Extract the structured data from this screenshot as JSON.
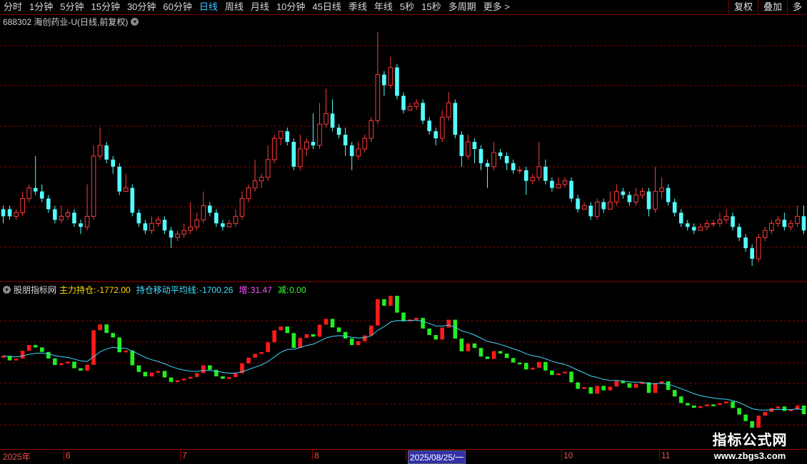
{
  "toolbar": {
    "tabs": [
      {
        "label": "分时",
        "active": false
      },
      {
        "label": "1分钟",
        "active": false
      },
      {
        "label": "5分钟",
        "active": false
      },
      {
        "label": "15分钟",
        "active": false
      },
      {
        "label": "30分钟",
        "active": false
      },
      {
        "label": "60分钟",
        "active": false
      },
      {
        "label": "日线",
        "active": true
      },
      {
        "label": "周线",
        "active": false
      },
      {
        "label": "月线",
        "active": false
      },
      {
        "label": "10分钟",
        "active": false
      },
      {
        "label": "45日线",
        "active": false
      },
      {
        "label": "季线",
        "active": false
      },
      {
        "label": "年线",
        "active": false
      },
      {
        "label": "5秒",
        "active": false
      },
      {
        "label": "15秒",
        "active": false
      },
      {
        "label": "多周期",
        "active": false
      },
      {
        "label": "更多 >",
        "active": false
      }
    ],
    "right_buttons": [
      "复权",
      "叠加",
      "多"
    ]
  },
  "price_panel": {
    "title": "688302 海创药业-U(日线,前复权)"
  },
  "indicator_panel": {
    "name": "股朋指标网",
    "main_label": "主力持仓:",
    "main_value": "-1772.00",
    "ma_label": "持仓移动平均线:",
    "ma_value": "-1700.26",
    "inc_label": "增:",
    "inc_value": "31.47",
    "dec_label": "减:",
    "dec_value": "0.00"
  },
  "colors": {
    "up": "#ff3b3b",
    "down": "#54ffff",
    "ma_line": "#3fd9ff",
    "ind_up": "#ff1a1a",
    "ind_down": "#22ee22",
    "grid": "#8a0000",
    "main_label": "#ffde00",
    "ma_label": "#40e0ff",
    "inc_label": "#ff55ff",
    "dec_label": "#33ff33"
  },
  "time_axis": {
    "labels": [
      "2025年",
      "6",
      "7",
      "8",
      "2025/08/25/一",
      "10",
      "11"
    ],
    "selected": "2025/08/25/一"
  },
  "watermark": {
    "line1": "指标公式网",
    "line2": "www.zbgs3.com"
  },
  "chart_data": {
    "type": "candlestick",
    "note_series": [
      "price ohlc (relative units)",
      "main force position",
      "position moving average"
    ],
    "candles": [
      [
        10,
        12,
        13,
        8,
        0
      ],
      [
        12,
        10,
        13,
        9,
        0
      ],
      [
        10,
        11,
        12,
        9,
        1
      ],
      [
        11,
        15,
        17,
        10,
        1
      ],
      [
        15,
        18,
        19,
        14,
        1
      ],
      [
        18,
        17,
        27,
        16,
        0
      ],
      [
        17,
        15,
        19,
        14,
        0
      ],
      [
        15,
        12,
        16,
        11,
        0
      ],
      [
        12,
        9,
        13,
        8,
        0
      ],
      [
        9,
        10,
        13,
        8,
        1
      ],
      [
        10,
        11,
        12,
        9,
        1
      ],
      [
        11,
        8,
        12,
        7,
        0
      ],
      [
        8,
        7,
        9,
        5,
        0
      ],
      [
        7,
        10,
        19,
        6,
        1
      ],
      [
        10,
        27,
        30,
        9,
        1
      ],
      [
        27,
        30,
        35,
        26,
        1
      ],
      [
        30,
        26,
        31,
        25,
        0
      ],
      [
        26,
        24,
        27,
        22,
        0
      ],
      [
        24,
        17,
        25,
        16,
        0
      ],
      [
        17,
        18,
        22,
        17,
        1
      ],
      [
        18,
        11,
        19,
        10,
        0
      ],
      [
        11,
        8,
        12,
        7,
        0
      ],
      [
        8,
        6,
        9,
        5,
        0
      ],
      [
        6,
        8,
        10,
        5,
        1
      ],
      [
        8,
        9,
        10,
        7,
        1
      ],
      [
        9,
        6,
        10,
        5,
        0
      ],
      [
        6,
        4,
        7,
        1,
        0
      ],
      [
        4,
        5,
        6,
        3,
        1
      ],
      [
        5,
        6,
        8,
        4,
        1
      ],
      [
        6,
        7,
        14,
        5,
        1
      ],
      [
        7,
        9,
        11,
        6,
        1
      ],
      [
        9,
        13,
        17,
        8,
        1
      ],
      [
        13,
        11,
        14,
        10,
        0
      ],
      [
        11,
        8,
        12,
        7,
        0
      ],
      [
        8,
        7,
        9,
        6,
        0
      ],
      [
        7,
        8,
        9,
        7,
        1
      ],
      [
        8,
        10,
        12,
        7,
        1
      ],
      [
        10,
        15,
        17,
        9,
        1
      ],
      [
        15,
        18,
        19,
        14,
        1
      ],
      [
        18,
        20,
        26,
        17,
        1
      ],
      [
        20,
        21,
        22,
        18,
        1
      ],
      [
        21,
        26,
        30,
        20,
        1
      ],
      [
        26,
        32,
        33,
        25,
        1
      ],
      [
        32,
        34,
        34,
        30,
        1
      ],
      [
        34,
        31,
        35,
        30,
        0
      ],
      [
        31,
        24,
        32,
        23,
        0
      ],
      [
        24,
        29,
        33,
        23,
        1
      ],
      [
        29,
        31,
        32,
        27,
        1
      ],
      [
        31,
        30,
        39,
        29,
        0
      ],
      [
        30,
        36,
        42,
        29,
        1
      ],
      [
        36,
        39,
        46,
        35,
        1
      ],
      [
        39,
        35,
        43,
        34,
        0
      ],
      [
        35,
        33,
        36,
        32,
        0
      ],
      [
        33,
        30,
        35,
        27,
        0
      ],
      [
        30,
        27,
        31,
        23,
        0
      ],
      [
        27,
        29,
        31,
        26,
        1
      ],
      [
        29,
        32,
        33,
        28,
        1
      ],
      [
        32,
        37,
        38,
        31,
        1
      ],
      [
        37,
        50,
        62,
        36,
        1
      ],
      [
        50,
        47,
        51,
        44,
        0
      ],
      [
        47,
        52,
        55,
        46,
        1
      ],
      [
        52,
        44,
        53,
        43,
        0
      ],
      [
        44,
        40,
        45,
        39,
        0
      ],
      [
        40,
        41,
        42,
        40,
        1
      ],
      [
        41,
        42,
        43,
        40,
        1
      ],
      [
        42,
        37,
        43,
        36,
        0
      ],
      [
        37,
        34,
        38,
        33,
        0
      ],
      [
        34,
        32,
        35,
        30,
        0
      ],
      [
        32,
        38,
        40,
        31,
        1
      ],
      [
        38,
        42,
        45,
        37,
        1
      ],
      [
        42,
        33,
        43,
        32,
        0
      ],
      [
        33,
        27,
        34,
        24,
        0
      ],
      [
        27,
        31,
        33,
        26,
        1
      ],
      [
        31,
        29,
        32,
        25,
        0
      ],
      [
        29,
        25,
        30,
        23,
        0
      ],
      [
        25,
        24,
        26,
        18,
        0
      ],
      [
        24,
        28,
        31,
        23,
        1
      ],
      [
        28,
        27,
        29,
        26,
        0
      ],
      [
        27,
        25,
        28,
        23,
        0
      ],
      [
        25,
        23,
        26,
        22,
        0
      ],
      [
        23,
        23,
        24,
        22,
        1
      ],
      [
        23,
        20,
        24,
        16,
        0
      ],
      [
        20,
        21,
        22,
        19,
        1
      ],
      [
        21,
        24,
        31,
        20,
        1
      ],
      [
        24,
        20,
        26,
        19,
        0
      ],
      [
        20,
        18,
        21,
        17,
        0
      ],
      [
        18,
        19,
        21,
        18,
        1
      ],
      [
        19,
        20,
        21,
        18,
        1
      ],
      [
        20,
        15,
        21,
        14,
        0
      ],
      [
        15,
        12,
        16,
        11,
        0
      ],
      [
        12,
        13,
        14,
        12,
        1
      ],
      [
        13,
        10,
        14,
        9,
        0
      ],
      [
        10,
        14,
        15,
        9,
        1
      ],
      [
        14,
        12,
        15,
        11,
        0
      ],
      [
        12,
        14,
        17,
        12,
        1
      ],
      [
        14,
        17,
        19,
        13,
        1
      ],
      [
        17,
        16,
        18,
        15,
        0
      ],
      [
        16,
        14,
        17,
        13,
        0
      ],
      [
        14,
        16,
        18,
        13,
        1
      ],
      [
        16,
        17,
        18,
        15,
        1
      ],
      [
        17,
        12,
        18,
        10,
        0
      ],
      [
        12,
        17,
        24,
        11,
        1
      ],
      [
        17,
        18,
        21,
        15,
        1
      ],
      [
        18,
        14,
        19,
        13,
        0
      ],
      [
        14,
        11,
        15,
        10,
        0
      ],
      [
        11,
        8,
        12,
        7,
        0
      ],
      [
        8,
        7,
        9,
        6,
        0
      ],
      [
        7,
        6,
        8,
        5,
        0
      ],
      [
        6,
        7,
        8,
        6,
        1
      ],
      [
        7,
        8,
        9,
        6,
        1
      ],
      [
        8,
        8,
        9,
        7,
        1
      ],
      [
        8,
        9,
        11,
        7,
        1
      ],
      [
        9,
        10,
        12,
        8,
        1
      ],
      [
        10,
        7,
        11,
        6,
        0
      ],
      [
        7,
        4,
        8,
        3,
        0
      ],
      [
        4,
        1,
        5,
        0,
        0
      ],
      [
        1,
        -2,
        2,
        -4,
        0
      ],
      [
        -2,
        4,
        5,
        -3,
        1
      ],
      [
        4,
        6,
        7,
        3,
        1
      ],
      [
        6,
        8,
        9,
        5,
        1
      ],
      [
        8,
        9,
        10,
        7,
        1
      ],
      [
        9,
        7,
        11,
        6,
        0
      ],
      [
        7,
        8,
        9,
        6,
        1
      ],
      [
        8,
        10,
        13,
        7,
        1
      ],
      [
        10,
        6,
        13,
        5,
        0
      ]
    ],
    "indicator_values": [],
    "ma_values": []
  }
}
